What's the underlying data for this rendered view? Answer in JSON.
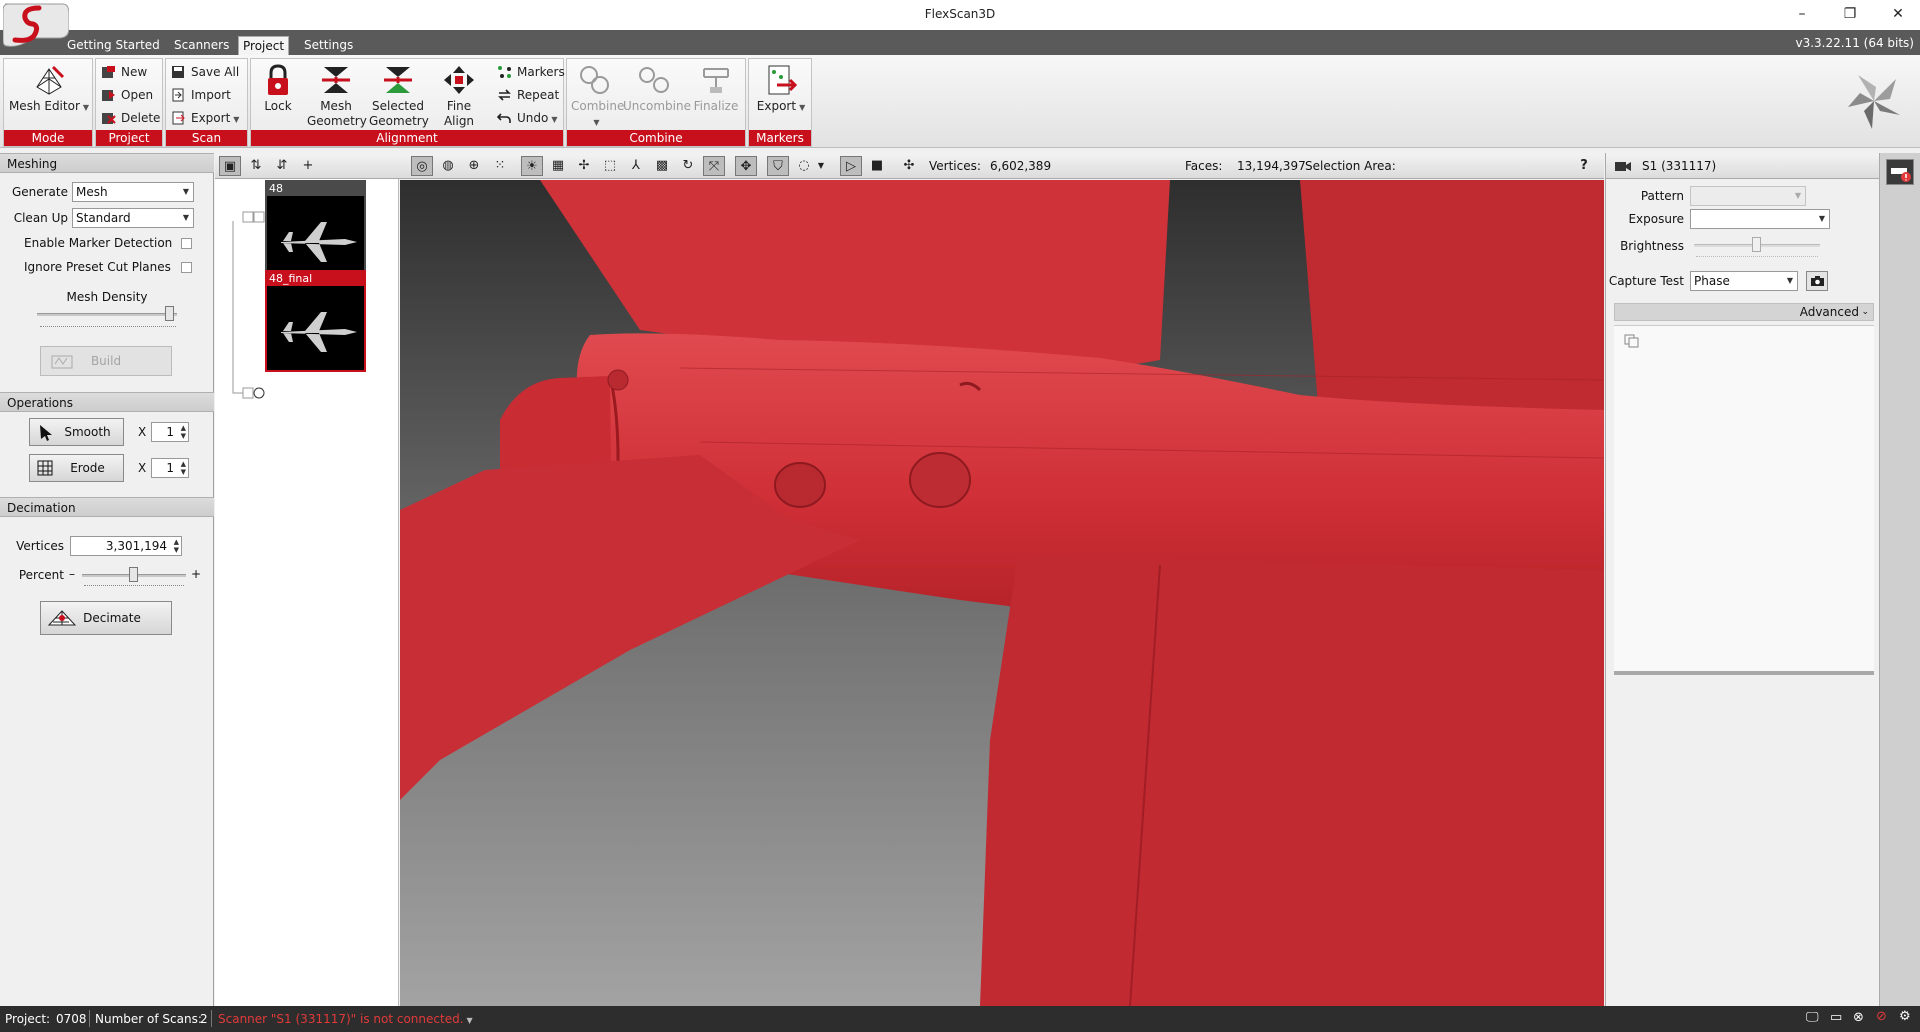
{
  "window": {
    "title": "FlexScan3D",
    "version": "v3.3.22.11  (64 bits)",
    "minimize": "–",
    "maximize": "❐",
    "close": "✕"
  },
  "menu": {
    "tabs": [
      "Getting Started",
      "Scanners",
      "Project",
      "Settings"
    ],
    "active": "Project"
  },
  "ribbon": {
    "mode": {
      "label": "Mode",
      "mesh_editor": "Mesh Editor"
    },
    "project": {
      "label": "Project",
      "new": "New",
      "open": "Open",
      "delete": "Delete"
    },
    "scan": {
      "label": "Scan",
      "save_all": "Save All",
      "import": "Import",
      "export": "Export"
    },
    "alignment": {
      "label": "Alignment",
      "lock": "Lock",
      "mesh_geometry": [
        "Mesh",
        "Geometry"
      ],
      "selected_geometry": [
        "Selected",
        "Geometry"
      ],
      "fine_align": "Fine Align",
      "markers": "Markers",
      "repeat": "Repeat",
      "undo": "Undo"
    },
    "combine": {
      "label": "Combine",
      "combine": "Combine",
      "uncombine": "Uncombine",
      "finalize": "Finalize"
    },
    "markers": {
      "label": "Markers",
      "export": "Export"
    }
  },
  "left_panel": {
    "meshing": {
      "title": "Meshing",
      "generate_label": "Generate",
      "generate_value": "Mesh",
      "cleanup_label": "Clean Up",
      "cleanup_value": "Standard",
      "enable_marker_detection": "Enable Marker Detection",
      "ignore_preset_cut_planes": "Ignore Preset Cut Planes",
      "mesh_density_label": "Mesh Density",
      "mesh_density_level": 0.95,
      "build": "Build"
    },
    "operations": {
      "title": "Operations",
      "smooth": "Smooth",
      "erode": "Erode",
      "x": "X",
      "smooth_count": "1",
      "erode_count": "1"
    },
    "decimation": {
      "title": "Decimation",
      "vertices_label": "Vertices",
      "vertices_value": "3,301,194",
      "percent_label": "Percent",
      "minus": "–",
      "plus": "+",
      "percent_level": 0.5,
      "decimate": "Decimate"
    }
  },
  "scans": [
    {
      "name": "48",
      "selected": false
    },
    {
      "name": "48_final",
      "selected": true
    }
  ],
  "viewport_toolbar": {
    "vertices_label": "Vertices:",
    "vertices_value": "6,602,389",
    "faces_label": "Faces:",
    "faces_value": "13,194,397",
    "selection_label": "Selection Area:",
    "help": "?"
  },
  "right_panel": {
    "scanner": "S1 (331117)",
    "pattern_label": "Pattern",
    "pattern_value": "",
    "exposure_label": "Exposure",
    "exposure_value": "",
    "brightness_label": "Brightness",
    "brightness_level": 0.5,
    "capture_test_label": "Capture Test",
    "capture_test_value": "Phase",
    "advanced": "Advanced"
  },
  "status": {
    "project_label": "Project:",
    "project_value": "0708",
    "scans_label": "Number of Scans:",
    "scans_value": "2",
    "message": "Scanner \"S1 (331117)\" is not connected."
  },
  "colors": {
    "accent": "#c8101d",
    "mesh": "#d0353b",
    "status_error": "#e23a3a"
  }
}
